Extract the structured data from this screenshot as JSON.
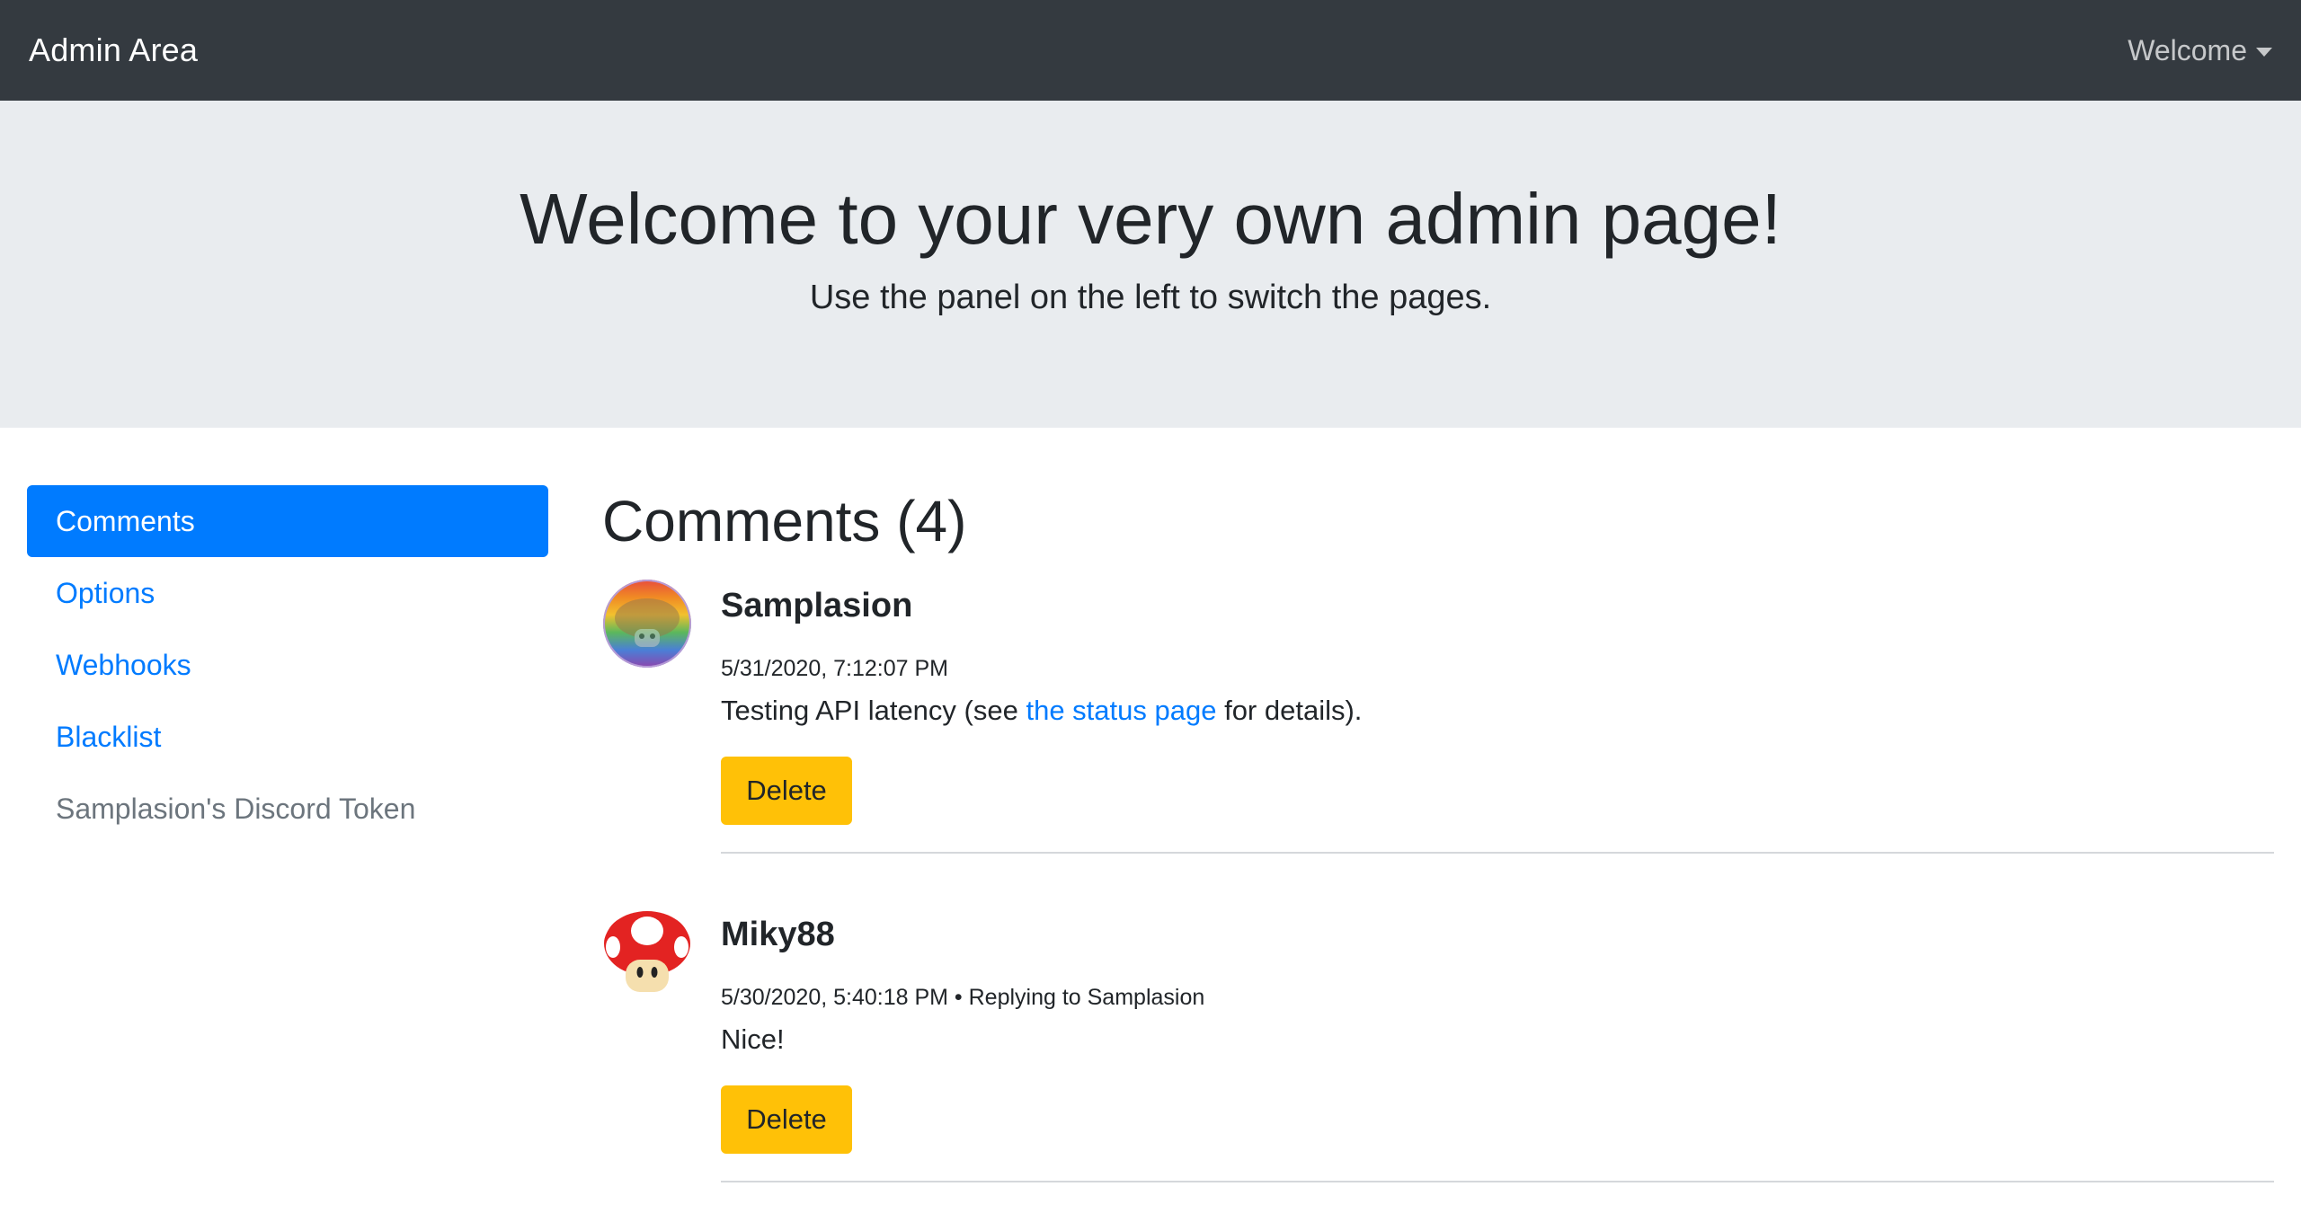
{
  "navbar": {
    "brand": "Admin Area",
    "dropdown_label": "Welcome"
  },
  "jumbotron": {
    "title": "Welcome to your very own admin page!",
    "lead": "Use the panel on the left to switch the pages."
  },
  "sidebar": {
    "items": [
      {
        "label": "Comments",
        "state": "active"
      },
      {
        "label": "Options",
        "state": "link"
      },
      {
        "label": "Webhooks",
        "state": "link"
      },
      {
        "label": "Blacklist",
        "state": "link"
      },
      {
        "label": "Samplasion's Discord Token",
        "state": "disabled"
      }
    ]
  },
  "main": {
    "title": "Comments (4)",
    "comments": [
      {
        "author": "Samplasion",
        "timestamp": "5/31/2020, 7:12:07 PM",
        "text_before": "Testing API latency (see ",
        "link_text": "the status page",
        "text_after": " for details).",
        "delete_label": "Delete",
        "avatar_icon": "rainbow-mushroom-avatar"
      },
      {
        "author": "Miky88",
        "timestamp": "5/30/2020, 5:40:18 PM",
        "reply_info": " • Replying to Samplasion",
        "text": "Nice!",
        "delete_label": "Delete",
        "avatar_icon": "red-mushroom-avatar"
      }
    ]
  },
  "colors": {
    "navbar_bg": "#343a40",
    "jumbotron_bg": "#e9ecef",
    "primary": "#007bff",
    "warning": "#ffc107",
    "muted": "#6c757d"
  }
}
